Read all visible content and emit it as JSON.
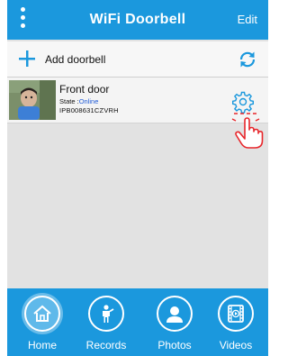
{
  "header": {
    "title": "WiFi Doorbell",
    "edit_label": "Edit",
    "menu_icon": "kebab-menu-icon"
  },
  "add_row": {
    "label": "Add doorbell",
    "add_icon": "plus-icon",
    "refresh_icon": "refresh-icon"
  },
  "devices": [
    {
      "name": "Front door",
      "state_label": "State :",
      "state_value": "Online",
      "uid": "IPB008631CZVRH",
      "settings_icon": "gear-icon"
    }
  ],
  "tabs": [
    {
      "label": "Home",
      "icon": "home-icon",
      "active": true
    },
    {
      "label": "Records",
      "icon": "person-icon",
      "active": false
    },
    {
      "label": "Photos",
      "icon": "user-icon",
      "active": false
    },
    {
      "label": "Videos",
      "icon": "film-icon",
      "active": false
    }
  ],
  "colors": {
    "accent": "#1b98dd",
    "online": "#1e5ad6",
    "tap_hint": "#e8262b"
  }
}
